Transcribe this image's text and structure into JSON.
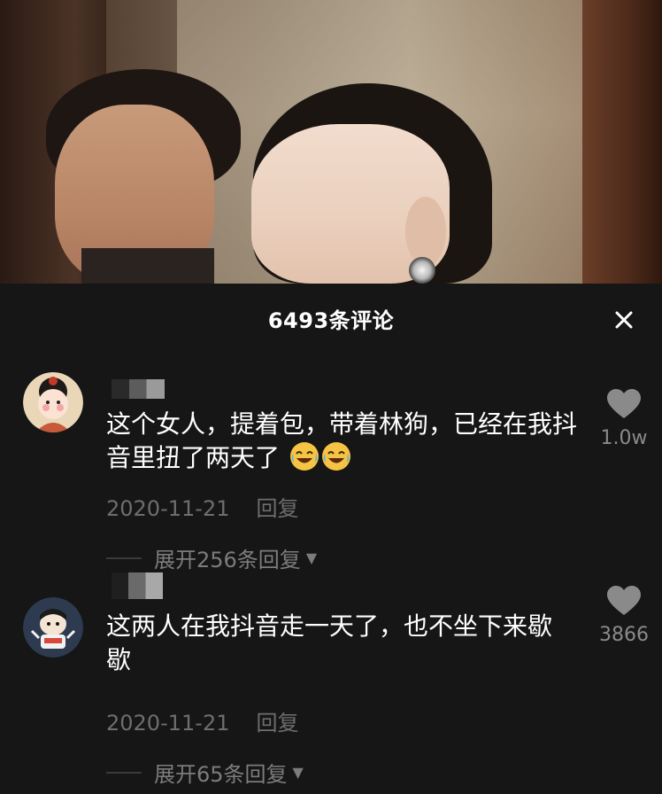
{
  "sheet": {
    "title": "6493条评论",
    "close_glyph": "✕"
  },
  "comments": [
    {
      "avatar_icon": "cartoon-girl-avatar-icon",
      "text": "这个女人，提着包，带着林狗，已经在我抖音里扭了两天了",
      "emojis": [
        "laughing-crying-emoji-icon",
        "laughing-crying-emoji-icon"
      ],
      "date": "2020-11-21",
      "reply_label": "回复",
      "expand_label": "展开256条回复",
      "like_count": "1.0w"
    },
    {
      "avatar_icon": "cartoon-character-avatar-icon",
      "text": "这两人在我抖音走一天了，也不坐下来歇歇",
      "emojis": [],
      "date": "2020-11-21",
      "reply_label": "回复",
      "expand_label": "展开65条回复",
      "like_count": "3866"
    }
  ],
  "colors": {
    "sheet_bg": "#161616",
    "primary_text": "#ffffff",
    "secondary_text": "#6e6e6e",
    "like_icon": "#8a8a8a"
  }
}
